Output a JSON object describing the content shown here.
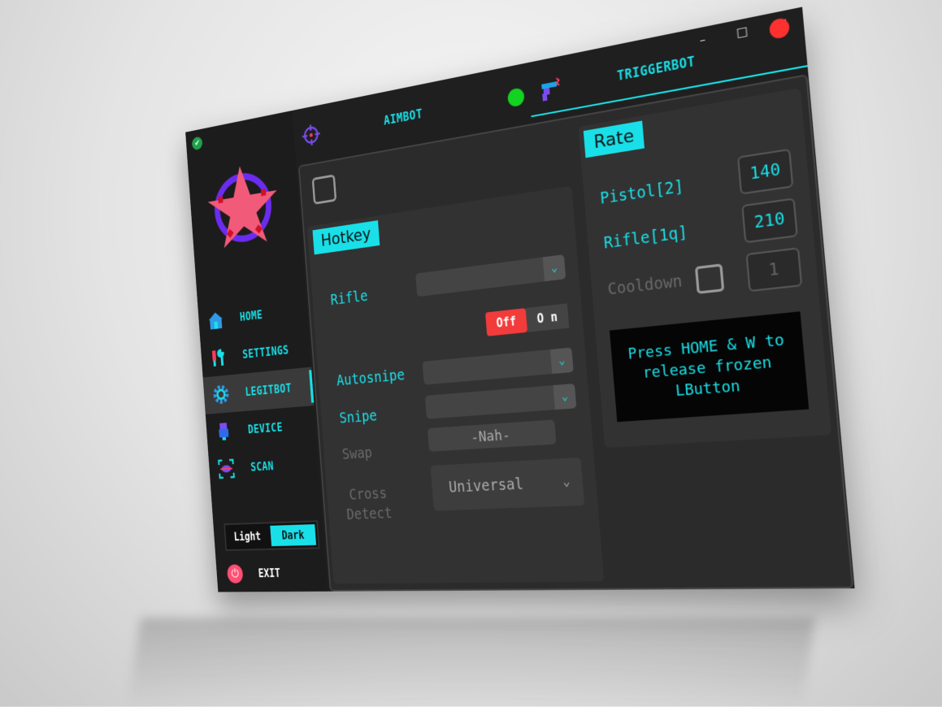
{
  "window": {
    "minimize_glyph": "–",
    "maximize_glyph": "□",
    "close_glyph": "✕"
  },
  "sidebar": {
    "items": [
      {
        "label": "HOME",
        "icon": "home-icon"
      },
      {
        "label": "SETTINGS",
        "icon": "tools-icon"
      },
      {
        "label": "LEGITBOT",
        "icon": "gear-icon"
      },
      {
        "label": "DEVICE",
        "icon": "usb-icon"
      },
      {
        "label": "SCAN",
        "icon": "scan-icon"
      }
    ],
    "active_index": 2,
    "theme_light": "Light",
    "theme_dark": "Dark",
    "exit_label": "EXIT"
  },
  "tabs": {
    "aimbot_label": "AIMBOT",
    "trigger_label": "TRIGGERBOT"
  },
  "hotkey": {
    "title": "Hotkey",
    "rifle_label": "Rifle",
    "autosnipe_label": "Autosnipe",
    "snipe_label": "Snipe",
    "swap_label": "Swap",
    "cross_label": "Cross",
    "detect_label": "Detect",
    "toggle_off": "Off",
    "toggle_on": "O n",
    "swap_value": "-Nah-",
    "cross_value": "Universal",
    "arrow": "⌄"
  },
  "rate": {
    "title": "Rate",
    "pistol_label": "Pistol[2]",
    "pistol_value": "140",
    "rifle_label": "Rifle[1q]",
    "rifle_value": "210",
    "cooldown_label": "Cooldown",
    "cooldown_value": "1",
    "notice": "Press HOME & W to release frozen LButton"
  },
  "colors": {
    "accent": "#19e0e8",
    "off_red": "#f23b3b",
    "status_green": "#12d320",
    "status_red": "#ff3030",
    "logo_pink": "#f25a7a",
    "logo_purple": "#6b2cf0"
  }
}
